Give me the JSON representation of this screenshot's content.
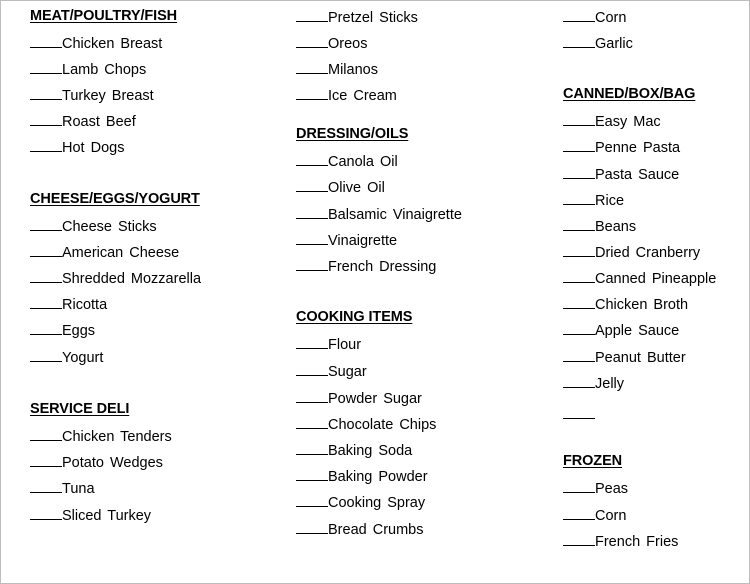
{
  "columns": [
    {
      "sections": [
        {
          "heading": "MEAT/POULTRY/FISH",
          "items": [
            "Chicken Breast",
            "Lamb Chops",
            "Turkey Breast",
            "Roast Beef",
            "Hot Dogs"
          ]
        },
        {
          "heading": "CHEESE/EGGS/YOGURT",
          "items": [
            "Cheese Sticks",
            "American Cheese",
            "Shredded Mozzarella",
            "Ricotta",
            "Eggs",
            "Yogurt"
          ]
        },
        {
          "heading": "SERVICE DELI",
          "items": [
            "Chicken Tenders",
            "Potato Wedges",
            "Tuna",
            "Sliced Turkey"
          ]
        }
      ]
    },
    {
      "sections": [
        {
          "heading": "",
          "items": [
            "Pretzel Sticks",
            "Oreos",
            "Milanos",
            "Ice Cream"
          ]
        },
        {
          "heading": "DRESSING/OILS",
          "items": [
            "Canola Oil",
            "Olive Oil",
            "Balsamic Vinaigrette",
            "Vinaigrette",
            "French Dressing"
          ]
        },
        {
          "heading": "COOKING ITEMS",
          "items": [
            "Flour",
            "Sugar",
            "Powder Sugar",
            "Chocolate Chips",
            "Baking Soda",
            "Baking Powder",
            "Cooking Spray",
            "Bread Crumbs"
          ]
        }
      ]
    },
    {
      "sections": [
        {
          "heading": "",
          "items": [
            "Corn",
            "Garlic"
          ]
        },
        {
          "heading": "CANNED/BOX/BAG",
          "items": [
            "Easy Mac",
            "Penne Pasta",
            "Pasta Sauce",
            "Rice",
            "Beans",
            "Dried Cranberry",
            "Canned Pineapple",
            "Chicken Broth",
            "Apple Sauce",
            "Peanut Butter",
            "Jelly",
            ""
          ]
        },
        {
          "heading": "FROZEN",
          "items": [
            "Peas",
            "Corn",
            "French Fries"
          ]
        }
      ]
    }
  ]
}
